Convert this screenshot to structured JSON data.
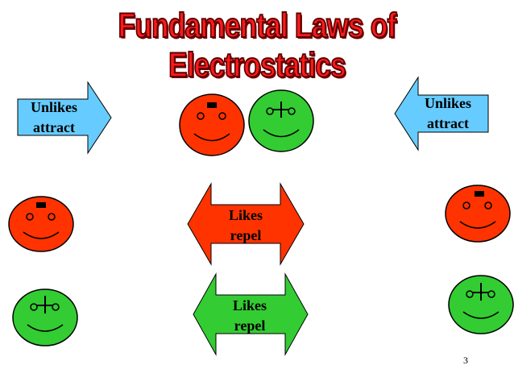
{
  "title": "Fundamental Laws of Electrostatics",
  "arrows": {
    "left_unlikes": {
      "line1": "Unlikes",
      "line2": "attract",
      "color": "#66ccff"
    },
    "right_unlikes": {
      "line1": "Unlikes",
      "line2": "attract",
      "color": "#66ccff"
    },
    "likes_red": {
      "line1": "Likes",
      "line2": "repel",
      "color": "#ff3300"
    },
    "likes_green": {
      "line1": "Likes",
      "line2": "repel",
      "color": "#33cc33"
    }
  },
  "faces": {
    "negative_color": "#ff3300",
    "positive_color": "#33cc33"
  },
  "page_number": "3"
}
